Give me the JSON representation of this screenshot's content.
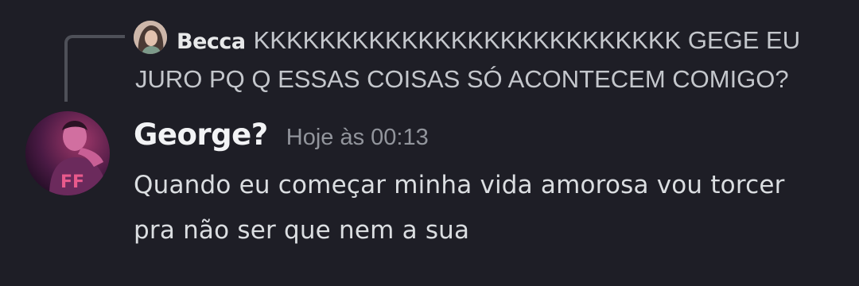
{
  "reply": {
    "author": "Becca",
    "text": "KKKKKKKKKKKKKKKKKKKKKKKKKK GEGE EU JURO PQ Q ESSAS COISAS SÓ ACONTECEM COMIGO?"
  },
  "message": {
    "username": "George?",
    "timestamp": "Hoje às 00:13",
    "content": "Quando eu começar minha vida amorosa vou torcer pra não ser que nem a sua"
  }
}
